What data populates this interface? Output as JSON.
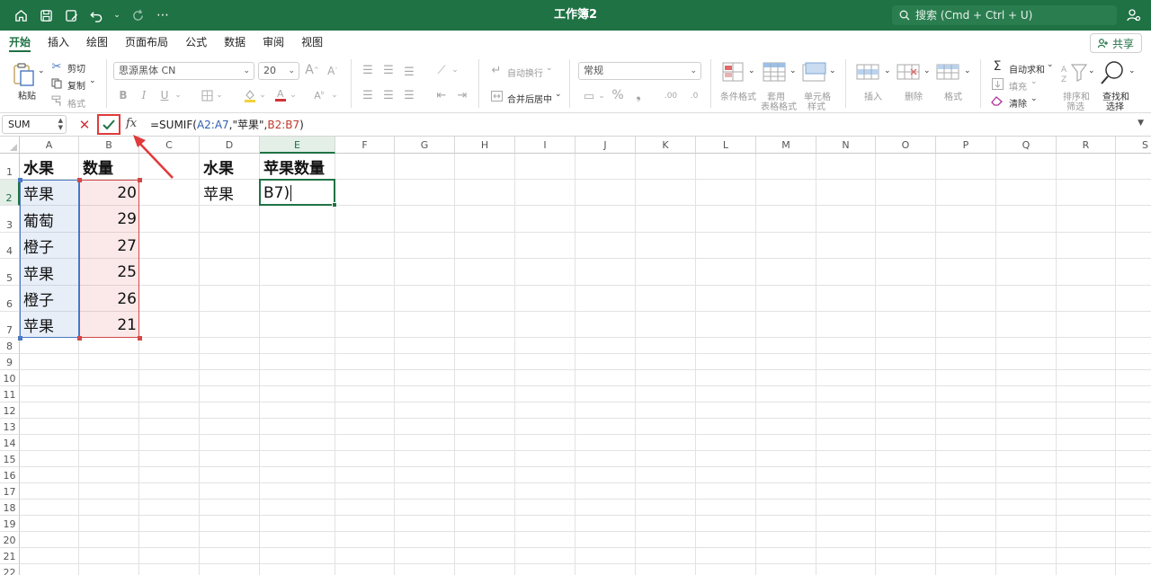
{
  "window": {
    "title": "工作簿2",
    "search_placeholder": "搜索 (Cmd + Ctrl + U)"
  },
  "menu": {
    "tabs": [
      "开始",
      "插入",
      "绘图",
      "页面布局",
      "公式",
      "数据",
      "审阅",
      "视图"
    ],
    "active_tab": "开始",
    "share_label": "共享"
  },
  "ribbon": {
    "clipboard": {
      "paste": "粘贴",
      "cut": "剪切",
      "copy": "复制",
      "format": "格式"
    },
    "font": {
      "name": "思源黑体 CN",
      "size": "20"
    },
    "alignment": {
      "wrap": "自动换行",
      "merge": "合并后居中"
    },
    "number": {
      "format": "常规"
    },
    "styles": {
      "conditional": "条件格式",
      "table_1": "套用",
      "table_2": "表格格式",
      "cell_style_1": "单元格",
      "cell_style_2": "样式"
    },
    "cells": {
      "insert": "插入",
      "delete": "删除",
      "format": "格式"
    },
    "editing": {
      "autosum": "自动求和",
      "fill": "填充",
      "clear": "清除",
      "sort_1": "排序和",
      "sort_2": "筛选",
      "find_1": "查找和",
      "find_2": "选择"
    }
  },
  "formula_bar": {
    "name_box": "SUM",
    "fx": "fx",
    "formula": {
      "prefix": "=SUMIF(",
      "arg1": "A2:A7",
      "mid": ",\"苹果\",",
      "arg3": "B2:B7",
      "suffix": ")"
    }
  },
  "sheet": {
    "columns": [
      "A",
      "B",
      "C",
      "D",
      "E",
      "F",
      "G",
      "H",
      "I",
      "J",
      "K",
      "L",
      "M",
      "N",
      "O",
      "P",
      "Q",
      "R",
      "S"
    ],
    "rows": [
      "1",
      "2",
      "3",
      "4",
      "5",
      "6",
      "7",
      "8",
      "9",
      "10",
      "11",
      "12",
      "13",
      "14",
      "15",
      "16",
      "17",
      "18",
      "19",
      "20",
      "21",
      "22"
    ],
    "active_column": "E",
    "active_row": "2",
    "cells": {
      "A1": "水果",
      "B1": "数量",
      "A2": "苹果",
      "B2": "20",
      "A3": "葡萄",
      "B3": "29",
      "A4": "橙子",
      "B4": "27",
      "A5": "苹果",
      "B5": "25",
      "A6": "橙子",
      "B6": "26",
      "A7": "苹果",
      "B7": "21",
      "D1": "水果",
      "E1": "苹果数量",
      "D2": "苹果"
    },
    "editing_text": "B7)"
  },
  "colors": {
    "accent": "#1f7244",
    "range_a": "#4a78c2",
    "range_b": "#d24848",
    "annotation": "#e03b3b"
  }
}
